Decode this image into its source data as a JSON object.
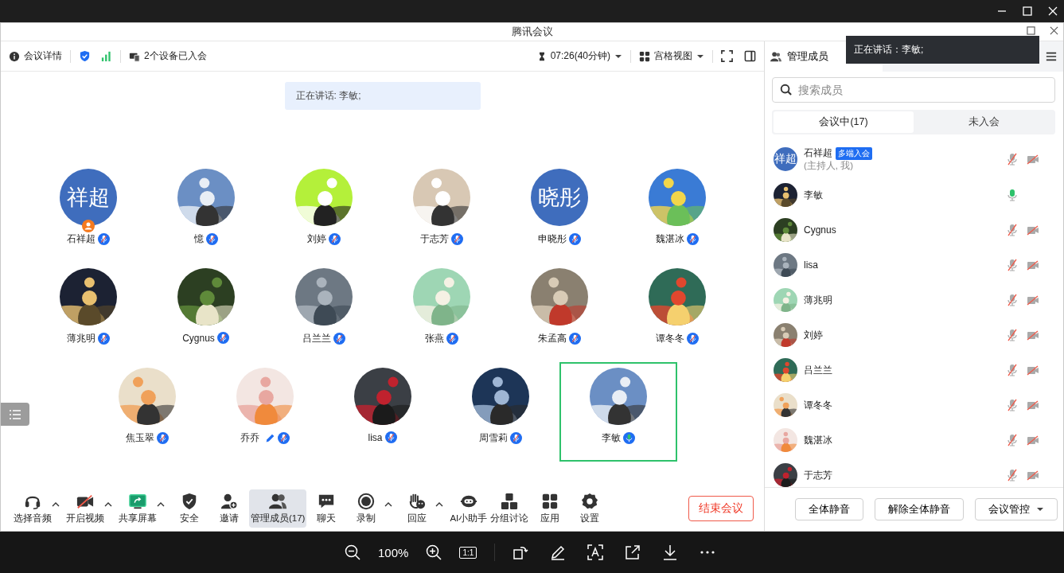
{
  "window": {
    "title": "腾讯会议"
  },
  "toolbar": {
    "details": "会议详情",
    "devices": "2个设备已入会",
    "timer": "07:26(40分钟)",
    "view": "宫格视图"
  },
  "speaking_banner": "正在讲话: 李敏;",
  "participants": [
    {
      "name": "石祥超",
      "avatar": {
        "kind": "text",
        "text": "祥超"
      },
      "muted": true,
      "host": true,
      "editing": false,
      "speaking": false
    },
    {
      "name": "憶",
      "muted": true,
      "host": false,
      "editing": false,
      "speaking": false
    },
    {
      "name": "刘婷",
      "muted": true,
      "host": false,
      "editing": false,
      "speaking": false
    },
    {
      "name": "于志芳",
      "muted": true,
      "host": false,
      "editing": false,
      "speaking": false
    },
    {
      "name": "申晓彤",
      "avatar": {
        "kind": "text",
        "text": "晓彤"
      },
      "muted": true,
      "host": false,
      "editing": false,
      "speaking": false
    },
    {
      "name": "魏湛冰",
      "muted": true,
      "host": false,
      "editing": false,
      "speaking": false
    },
    {
      "name": "薄兆明",
      "muted": true,
      "host": false,
      "editing": false,
      "speaking": false
    },
    {
      "name": "Cygnus",
      "muted": true,
      "host": false,
      "editing": false,
      "speaking": false
    },
    {
      "name": "吕兰兰",
      "muted": true,
      "host": false,
      "editing": false,
      "speaking": false
    },
    {
      "name": "张燕",
      "muted": true,
      "host": false,
      "editing": false,
      "speaking": false
    },
    {
      "name": "朱孟高",
      "muted": true,
      "host": false,
      "editing": false,
      "speaking": false
    },
    {
      "name": "谭冬冬",
      "muted": true,
      "host": false,
      "editing": false,
      "speaking": false
    },
    {
      "name": "焦玉翠",
      "muted": true,
      "host": false,
      "editing": false,
      "speaking": false
    },
    {
      "name": "乔乔",
      "muted": true,
      "host": false,
      "editing": true,
      "speaking": false
    },
    {
      "name": "lisa",
      "muted": true,
      "host": false,
      "editing": false,
      "speaking": false
    },
    {
      "name": "周雪莉",
      "muted": true,
      "host": false,
      "editing": false,
      "speaking": false
    },
    {
      "name": "李敏",
      "muted": false,
      "host": false,
      "editing": false,
      "speaking": true
    }
  ],
  "controls": [
    {
      "label": "选择音频",
      "kind": "audio",
      "menu": true,
      "selected": false
    },
    {
      "label": "开启视频",
      "kind": "video",
      "menu": true,
      "selected": false
    },
    {
      "label": "共享屏幕",
      "kind": "share",
      "menu": true,
      "selected": false
    },
    {
      "label": "安全",
      "kind": "security",
      "menu": false,
      "selected": false
    },
    {
      "label": "邀请",
      "kind": "invite",
      "menu": false,
      "selected": false
    },
    {
      "label": "管理成员(17)",
      "kind": "members",
      "menu": false,
      "selected": true
    },
    {
      "label": "聊天",
      "kind": "chat",
      "menu": false,
      "selected": false
    },
    {
      "label": "录制",
      "kind": "record",
      "menu": true,
      "selected": false
    },
    {
      "label": "回应",
      "kind": "reaction",
      "menu": true,
      "selected": false
    },
    {
      "label": "AI小助手",
      "kind": "assistant",
      "menu": false,
      "selected": false
    },
    {
      "label": "分组讨论",
      "kind": "breakout",
      "menu": false,
      "selected": false
    },
    {
      "label": "应用",
      "kind": "apps",
      "menu": false,
      "selected": false
    },
    {
      "label": "设置",
      "kind": "settings",
      "menu": false,
      "selected": false
    }
  ],
  "end_button": "结束会议",
  "panel": {
    "tab": {
      "label": "管理成员",
      "selected": true
    },
    "search": {
      "placeholder": "搜索成员"
    },
    "segments": [
      {
        "label": "会议中(17)",
        "selected": true
      },
      {
        "label": "未入会",
        "selected": false
      }
    ],
    "members": [
      {
        "name": "石祥超",
        "avatar": {
          "kind": "text",
          "text": "祥超"
        },
        "tag": "多端入会",
        "role": "(主持人, 我)",
        "muted": true,
        "camera_off": true
      },
      {
        "name": "李敏",
        "muted": false,
        "camera_off": false
      },
      {
        "name": "Cygnus",
        "muted": true,
        "camera_off": true
      },
      {
        "name": "lisa",
        "muted": true,
        "camera_off": true
      },
      {
        "name": "薄兆明",
        "muted": true,
        "camera_off": true
      },
      {
        "name": "刘婷",
        "muted": true,
        "camera_off": true
      },
      {
        "name": "吕兰兰",
        "muted": true,
        "camera_off": true
      },
      {
        "name": "谭冬冬",
        "muted": true,
        "camera_off": true
      },
      {
        "name": "魏湛冰",
        "muted": true,
        "camera_off": true
      },
      {
        "name": "于志芳",
        "muted": true,
        "camera_off": true
      }
    ],
    "buttons": [
      {
        "label": "全体静音",
        "dropdown": false
      },
      {
        "label": "解除全体静音",
        "dropdown": false
      },
      {
        "label": "会议管控",
        "dropdown": true
      }
    ]
  },
  "toast": "正在讲话：李敏;",
  "viewer": {
    "zoom": "100%",
    "actual_size": "1:1"
  }
}
